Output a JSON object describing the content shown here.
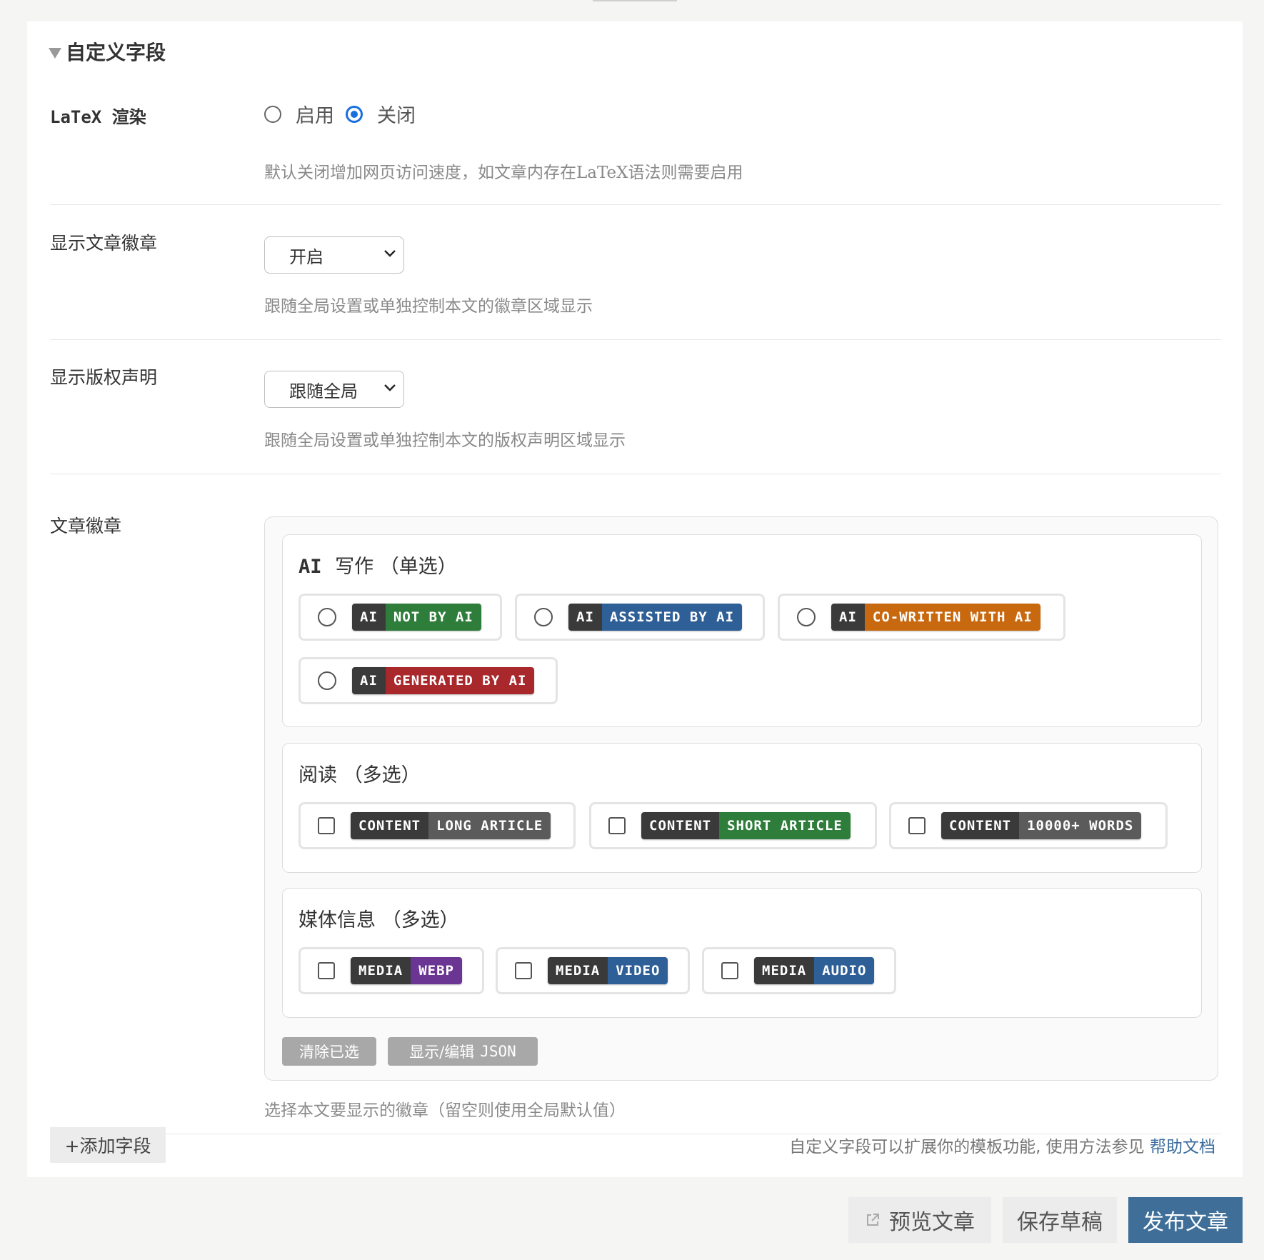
{
  "section": {
    "title": "自定义字段"
  },
  "latex": {
    "label": "LaTeX 渲染",
    "options": [
      "启用",
      "关闭"
    ],
    "selected": "关闭",
    "description": "默认关闭增加网页访问速度，如文章内存在LaTeX语法则需要启用"
  },
  "show_badges": {
    "label": "显示文章徽章",
    "value": "开启",
    "description": "跟随全局设置或单独控制本文的徽章区域显示"
  },
  "show_copyright": {
    "label": "显示版权声明",
    "value": "跟随全局",
    "description": "跟随全局设置或单独控制本文的版权声明区域显示"
  },
  "badges": {
    "label": "文章徽章",
    "ai_group": {
      "title_prefix": "AI",
      "title": "写作 （单选）",
      "options": [
        {
          "left": "AI",
          "right": "NOT BY AI",
          "color": "#2e7d3a"
        },
        {
          "left": "AI",
          "right": "ASSISTED BY AI",
          "color": "#2e5f96"
        },
        {
          "left": "AI",
          "right": "CO-WRITTEN WITH AI",
          "color": "#c8680f"
        },
        {
          "left": "AI",
          "right": "GENERATED BY AI",
          "color": "#a8282c"
        }
      ]
    },
    "reading_group": {
      "title": "阅读 （多选）",
      "options": [
        {
          "left": "CONTENT",
          "right": "LONG ARTICLE",
          "color": "#5b5b5b"
        },
        {
          "left": "CONTENT",
          "right": "SHORT ARTICLE",
          "color": "#2e7d3a"
        },
        {
          "left": "CONTENT",
          "right": "10000+ WORDS",
          "color": "#5b5b5b"
        }
      ]
    },
    "media_group": {
      "title": "媒体信息 （多选）",
      "options": [
        {
          "left": "MEDIA",
          "right": "WEBP",
          "color": "#6a3593"
        },
        {
          "left": "MEDIA",
          "right": "VIDEO",
          "color": "#2e5f96"
        },
        {
          "left": "MEDIA",
          "right": "AUDIO",
          "color": "#2e5f96"
        }
      ]
    },
    "clear_button": "清除已选",
    "json_button_prefix": "显示/编辑",
    "json_button_suffix": "JSON",
    "description": "选择本文要显示的徽章（留空则使用全局默认值）"
  },
  "footer": {
    "add_field": "+添加字段",
    "help_text": "自定义字段可以扩展你的模板功能, 使用方法参见",
    "help_link": "帮助文档"
  },
  "actions": {
    "preview": "预览文章",
    "save_draft": "保存草稿",
    "publish": "发布文章"
  },
  "colors": {
    "accent": "#3f6f98",
    "radio_checked": "#1a6fe0",
    "badge_dark": "#3a3a3a"
  }
}
